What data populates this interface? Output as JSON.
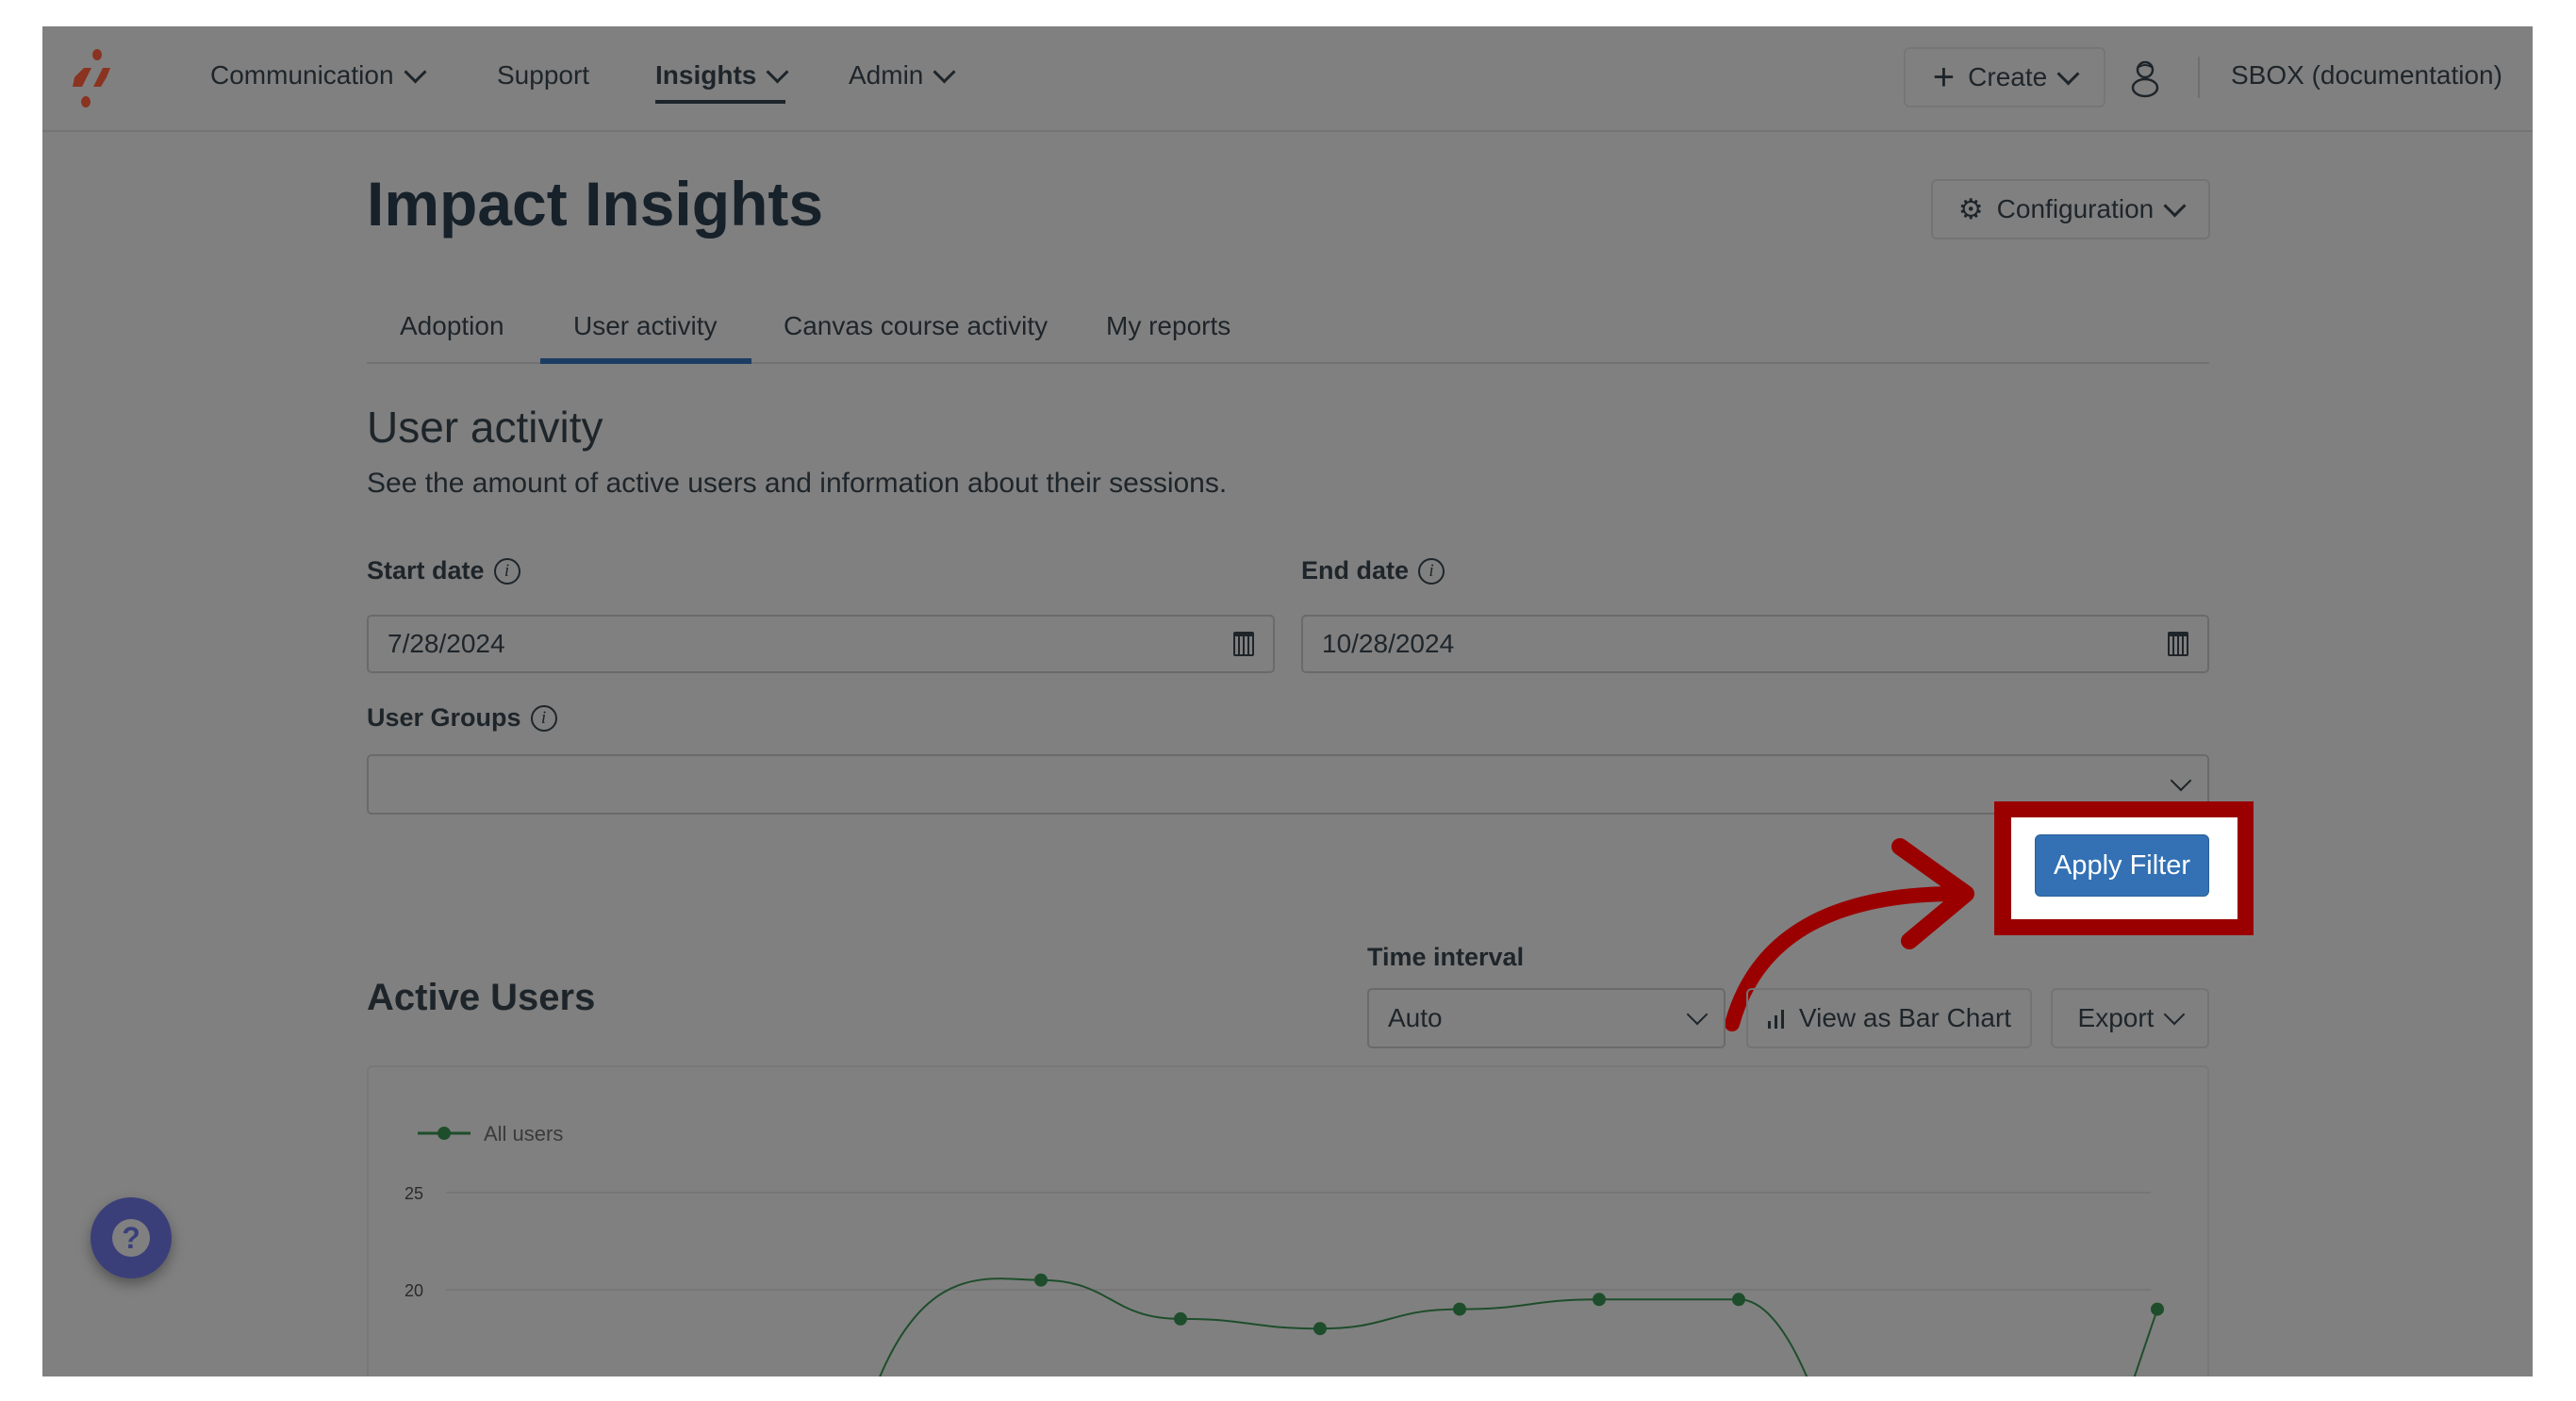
{
  "nav": {
    "items": [
      {
        "label": "Communication",
        "has_dropdown": true,
        "active": false
      },
      {
        "label": "Support",
        "has_dropdown": false,
        "active": false
      },
      {
        "label": "Insights",
        "has_dropdown": true,
        "active": true
      },
      {
        "label": "Admin",
        "has_dropdown": true,
        "active": false
      }
    ],
    "create_label": "Create",
    "account_label": "SBOX (documentation)",
    "icons": {
      "logo": "brand-logo-icon",
      "create": "plus-icon",
      "user": "user-icon"
    }
  },
  "page": {
    "title": "Impact Insights",
    "config_label": "Configuration",
    "tabs": [
      {
        "label": "Adoption",
        "active": false
      },
      {
        "label": "User activity",
        "active": true
      },
      {
        "label": "Canvas course activity",
        "active": false
      },
      {
        "label": "My reports",
        "active": false
      }
    ]
  },
  "section": {
    "heading": "User activity",
    "description": "See the amount of active users and information about their sessions."
  },
  "filters": {
    "start_date_label": "Start date",
    "start_date_value": "7/28/2024",
    "end_date_label": "End date",
    "end_date_value": "10/28/2024",
    "user_groups_label": "User Groups",
    "user_groups_value": "",
    "apply_label": "Apply Filter"
  },
  "active_users": {
    "heading": "Active Users",
    "time_interval_label": "Time interval",
    "time_interval_value": "Auto",
    "bar_chart_label": "View as Bar Chart",
    "export_label": "Export"
  },
  "colors": {
    "apply_button": "#3371B4",
    "highlight": "#9B0000",
    "series": "#1E4D2B",
    "help_button": "#3A3F7A",
    "brand": "#8A3320"
  },
  "chart_data": {
    "type": "line",
    "title": "",
    "legend": [
      "All users"
    ],
    "legend_position": "top-left",
    "ylabel": "",
    "xlabel": "",
    "y_ticks": [
      20,
      25
    ],
    "ylim_visible": [
      17,
      26
    ],
    "grid": true,
    "series": [
      {
        "name": "All users",
        "points": [
          {
            "index": 1,
            "value": 20.5
          },
          {
            "index": 2,
            "value": 18.5
          },
          {
            "index": 3,
            "value": 18.0
          },
          {
            "index": 4,
            "value": 19.0
          },
          {
            "index": 5,
            "value": 19.5
          },
          {
            "index": 6,
            "value": 19.5
          },
          {
            "index": 9,
            "value": 19.0
          }
        ]
      }
    ]
  },
  "help": {
    "icon": "help-icon"
  }
}
